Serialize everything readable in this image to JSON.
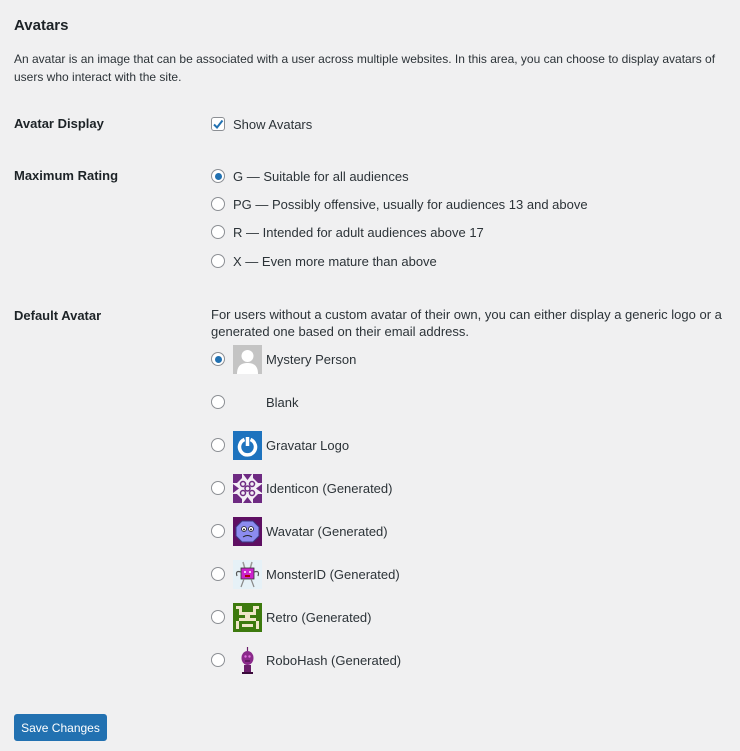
{
  "section": {
    "title": "Avatars",
    "description": "An avatar is an image that can be associated with a user across multiple websites. In this area, you can choose to display avatars of users who interact with the site."
  },
  "avatar_display": {
    "label": "Avatar Display",
    "checkbox_label": "Show Avatars",
    "checked": true
  },
  "max_rating": {
    "label": "Maximum Rating",
    "selected": "G",
    "options": [
      {
        "value": "G",
        "label": "G — Suitable for all audiences"
      },
      {
        "value": "PG",
        "label": "PG — Possibly offensive, usually for audiences 13 and above"
      },
      {
        "value": "R",
        "label": "R — Intended for adult audiences above 17"
      },
      {
        "value": "X",
        "label": "X — Even more mature than above"
      }
    ]
  },
  "default_avatar": {
    "label": "Default Avatar",
    "description": "For users without a custom avatar of their own, you can either display a generic logo or a generated one based on their email address.",
    "selected": "mystery",
    "options": [
      {
        "value": "mystery",
        "label": "Mystery Person",
        "icon": "mystery-person-icon"
      },
      {
        "value": "blank",
        "label": "Blank",
        "icon": "blank-icon"
      },
      {
        "value": "gravatar_default",
        "label": "Gravatar Logo",
        "icon": "gravatar-logo-icon"
      },
      {
        "value": "identicon",
        "label": "Identicon (Generated)",
        "icon": "identicon-icon"
      },
      {
        "value": "wavatar",
        "label": "Wavatar (Generated)",
        "icon": "wavatar-icon"
      },
      {
        "value": "monsterid",
        "label": "MonsterID (Generated)",
        "icon": "monsterid-icon"
      },
      {
        "value": "retro",
        "label": "Retro (Generated)",
        "icon": "retro-icon"
      },
      {
        "value": "robohash",
        "label": "RoboHash (Generated)",
        "icon": "robohash-icon"
      }
    ]
  },
  "footer": {
    "save_label": "Save Changes"
  },
  "colors": {
    "accent": "#2271b1",
    "background": "#f0f0f1"
  }
}
